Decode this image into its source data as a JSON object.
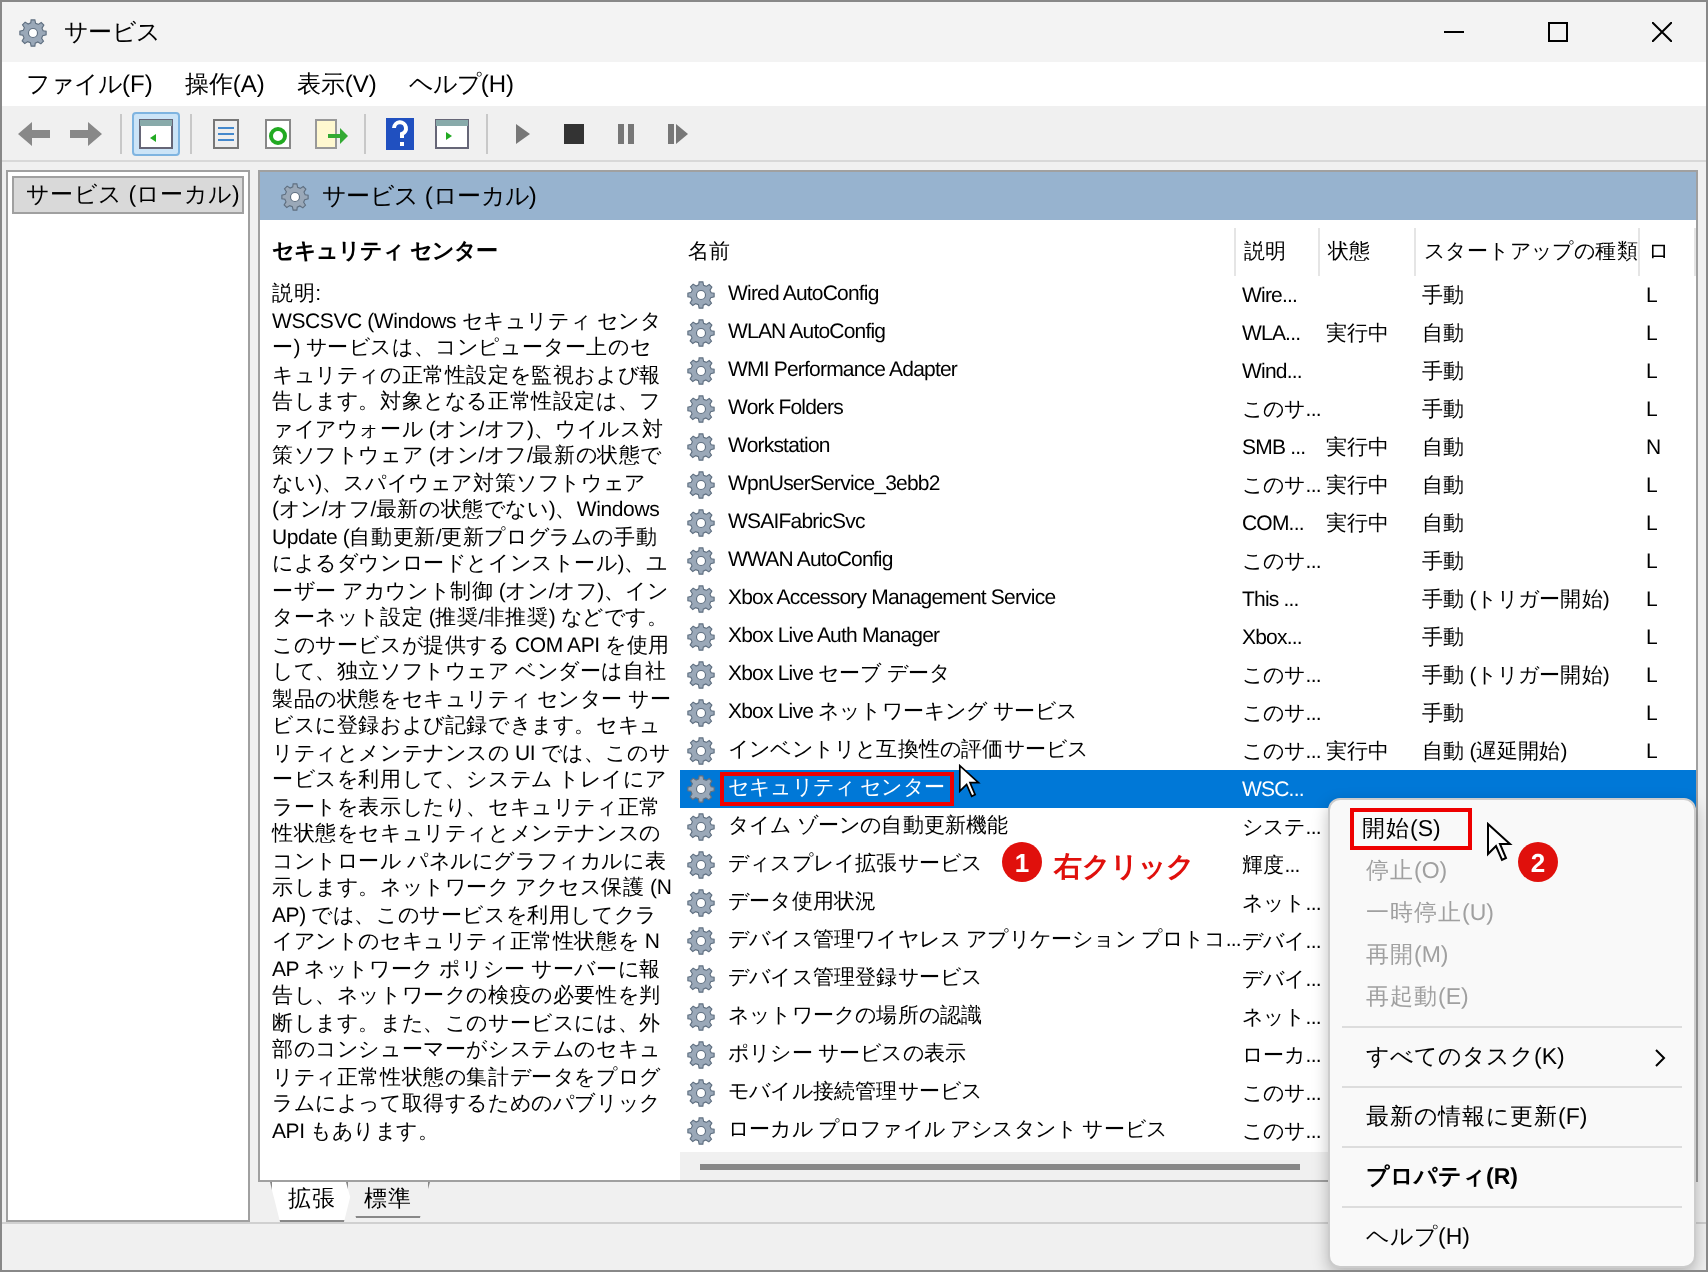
{
  "window": {
    "title": "サービス"
  },
  "menu": [
    "ファイル(F)",
    "操作(A)",
    "表示(V)",
    "ヘルプ(H)"
  ],
  "toolbar": [
    {
      "kind": "back",
      "disabled": false,
      "pressed": false
    },
    {
      "kind": "forward",
      "disabled": false,
      "pressed": false
    },
    {
      "kind": "sep"
    },
    {
      "kind": "tree",
      "disabled": false,
      "pressed": true
    },
    {
      "kind": "sep"
    },
    {
      "kind": "properties",
      "disabled": false,
      "pressed": false
    },
    {
      "kind": "refresh",
      "disabled": false,
      "pressed": false
    },
    {
      "kind": "export",
      "disabled": false,
      "pressed": false
    },
    {
      "kind": "sep"
    },
    {
      "kind": "help",
      "disabled": false,
      "pressed": false
    },
    {
      "kind": "console",
      "disabled": false,
      "pressed": false
    },
    {
      "kind": "sep"
    },
    {
      "kind": "play",
      "disabled": false,
      "pressed": false
    },
    {
      "kind": "stop",
      "disabled": false,
      "pressed": false
    },
    {
      "kind": "pause",
      "disabled": false,
      "pressed": false
    },
    {
      "kind": "restart",
      "disabled": false,
      "pressed": false
    }
  ],
  "tree": {
    "items": [
      {
        "label": "サービス (ローカル)",
        "selected": true
      }
    ]
  },
  "panel_header": {
    "title": "サービス (ローカル)"
  },
  "description": {
    "title": "セキュリティ センター",
    "label": "説明:",
    "text": "WSCSVC (Windows セキュリティ センター) サービスは、コンピューター上のセキュリティの正常性設定を監視および報告します。対象となる正常性設定は、ファイアウォール (オン/オフ)、ウイルス対策ソフトウェア (オン/オフ/最新の状態でない)、スパイウェア対策ソフトウェア (オン/オフ/最新の状態でない)、Windows Update (自動更新/更新プログラムの手動によるダウンロードとインストール)、ユーザー アカウント制御 (オン/オフ)、インターネット設定 (推奨/非推奨) などです。このサービスが提供する COM API を使用して、独立ソフトウェア ベンダーは自社製品の状態をセキュリティ センター サービスに登録および記録できます。セキュリティとメンテナンスの UI では、このサービスを利用して、システム トレイにアラートを表示したり、セキュリティ正常性状態をセキュリティとメンテナンスのコントロール パネルにグラフィカルに表示します。ネットワーク アクセス保護 (NAP) では、このサービスを利用してクライアントのセキュリティ正常性状態を NAP ネットワーク ポリシー サーバーに報告し、ネットワークの検疫の必要性を判断します。また、このサービスには、外部のコンシューマーがシステムのセキュリティ正常性状態の集計データをプログラムによって取得するためのパブリック API もあります。"
  },
  "table": {
    "columns": [
      "名前",
      "説明",
      "状態",
      "スタートアップの種類",
      "ロ"
    ],
    "rows": [
      {
        "name": "Wired AutoConfig",
        "description": "Wire...",
        "status": "",
        "startup": "手動",
        "column_5": "L",
        "selected": false,
        "outlined": false
      },
      {
        "name": "WLAN AutoConfig",
        "description": "WLA...",
        "status": "実行中",
        "startup": "自動",
        "column_5": "L",
        "selected": false,
        "outlined": false
      },
      {
        "name": "WMI Performance Adapter",
        "description": "Wind...",
        "status": "",
        "startup": "手動",
        "column_5": "L",
        "selected": false,
        "outlined": false
      },
      {
        "name": "Work Folders",
        "description": "このサ...",
        "status": "",
        "startup": "手動",
        "column_5": "L",
        "selected": false,
        "outlined": false
      },
      {
        "name": "Workstation",
        "description": "SMB ...",
        "status": "実行中",
        "startup": "自動",
        "column_5": "N",
        "selected": false,
        "outlined": false
      },
      {
        "name": "WpnUserService_3ebb2",
        "description": "このサ...",
        "status": "実行中",
        "startup": "自動",
        "column_5": "L",
        "selected": false,
        "outlined": false
      },
      {
        "name": "WSAIFabricSvc",
        "description": "COM...",
        "status": "実行中",
        "startup": "自動",
        "column_5": "L",
        "selected": false,
        "outlined": false
      },
      {
        "name": "WWAN AutoConfig",
        "description": "このサ...",
        "status": "",
        "startup": "手動",
        "column_5": "L",
        "selected": false,
        "outlined": false
      },
      {
        "name": "Xbox Accessory Management Service",
        "description": "This ...",
        "status": "",
        "startup": "手動 (トリガー開始)",
        "column_5": "L",
        "selected": false,
        "outlined": false
      },
      {
        "name": "Xbox Live Auth Manager",
        "description": "Xbox...",
        "status": "",
        "startup": "手動",
        "column_5": "L",
        "selected": false,
        "outlined": false
      },
      {
        "name": "Xbox Live セーブ データ",
        "description": "このサ...",
        "status": "",
        "startup": "手動 (トリガー開始)",
        "column_5": "L",
        "selected": false,
        "outlined": false
      },
      {
        "name": "Xbox Live ネットワーキング サービス",
        "description": "このサ...",
        "status": "",
        "startup": "手動",
        "column_5": "L",
        "selected": false,
        "outlined": false
      },
      {
        "name": "インベントリと互換性の評価サービス",
        "description": "このサ...",
        "status": "実行中",
        "startup": "自動 (遅延開始)",
        "column_5": "L",
        "selected": false,
        "outlined": false
      },
      {
        "name": "セキュリティ センター",
        "description": "WSC...",
        "status": "",
        "startup": "",
        "column_5": "",
        "selected": true,
        "outlined": true
      },
      {
        "name": "タイム ゾーンの自動更新機能",
        "description": "システ...",
        "status": "",
        "startup": "",
        "column_5": "",
        "selected": false,
        "outlined": false
      },
      {
        "name": "ディスプレイ拡張サービス",
        "description": "輝度...",
        "status": "",
        "startup": "",
        "column_5": "",
        "selected": false,
        "outlined": false
      },
      {
        "name": "データ使用状況",
        "description": "ネット...",
        "status": "",
        "startup": "",
        "column_5": "",
        "selected": false,
        "outlined": false
      },
      {
        "name": "デバイス管理ワイヤレス アプリケーション プロトコ...",
        "description": "デバイ...",
        "status": "",
        "startup": "",
        "column_5": "",
        "selected": false,
        "outlined": false
      },
      {
        "name": "デバイス管理登録サービス",
        "description": "デバイ...",
        "status": "",
        "startup": "",
        "column_5": "",
        "selected": false,
        "outlined": false
      },
      {
        "name": "ネットワークの場所の認識",
        "description": "ネット...",
        "status": "",
        "startup": "",
        "column_5": "",
        "selected": false,
        "outlined": false
      },
      {
        "name": "ポリシー サービスの表示",
        "description": "ローカ...",
        "status": "",
        "startup": "",
        "column_5": "",
        "selected": false,
        "outlined": false
      },
      {
        "name": "モバイル接続管理サービス",
        "description": "このサ...",
        "status": "",
        "startup": "",
        "column_5": "",
        "selected": false,
        "outlined": false
      },
      {
        "name": "ローカル プロファイル アシスタント サービス",
        "description": "このサ...",
        "status": "",
        "startup": "",
        "column_5": "",
        "selected": false,
        "outlined": false
      }
    ]
  },
  "view_tabs": [
    {
      "label": "拡張",
      "selected": true
    },
    {
      "label": "標準",
      "selected": false
    }
  ],
  "context_menu": {
    "items": [
      {
        "kind": "item",
        "label": "開始(S)",
        "disabled": false,
        "bold": false,
        "outlined": true
      },
      {
        "kind": "item",
        "label": "停止(O)",
        "disabled": true,
        "bold": false,
        "outlined": false
      },
      {
        "kind": "item",
        "label": "一時停止(U)",
        "disabled": true,
        "bold": false,
        "outlined": false
      },
      {
        "kind": "item",
        "label": "再開(M)",
        "disabled": true,
        "bold": false,
        "outlined": false
      },
      {
        "kind": "item",
        "label": "再起動(E)",
        "disabled": true,
        "bold": false,
        "outlined": false
      },
      {
        "kind": "separator"
      },
      {
        "kind": "submenu",
        "label": "すべてのタスク(K)",
        "disabled": false,
        "bold": false,
        "outlined": false
      },
      {
        "kind": "separator"
      },
      {
        "kind": "item",
        "label": "最新の情報に更新(F)",
        "disabled": false,
        "bold": false,
        "outlined": false
      },
      {
        "kind": "separator"
      },
      {
        "kind": "item",
        "label": "プロパティ(R)",
        "disabled": false,
        "bold": true,
        "outlined": false
      },
      {
        "kind": "separator"
      },
      {
        "kind": "item",
        "label": "ヘルプ(H)",
        "disabled": false,
        "bold": false,
        "outlined": false
      }
    ]
  },
  "annotations": [
    {
      "number": "1",
      "label": "右クリック"
    },
    {
      "number": "2"
    }
  ]
}
